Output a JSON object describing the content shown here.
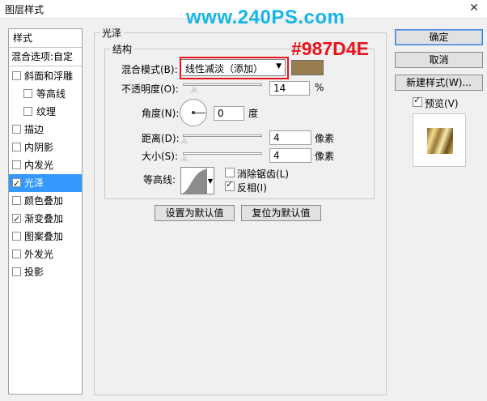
{
  "window": {
    "title": "图层样式",
    "close_glyph": "✕"
  },
  "watermark": "www.240PS.com",
  "annotation_color": "#987D4E",
  "left_list": {
    "header": "样式",
    "blend_options": "混合选项:自定",
    "items": [
      {
        "label": "斜面和浮雕",
        "checked": false
      },
      {
        "label": "等高线",
        "checked": false
      },
      {
        "label": "纹理",
        "checked": false
      },
      {
        "label": "描边",
        "checked": false
      },
      {
        "label": "内阴影",
        "checked": false
      },
      {
        "label": "内发光",
        "checked": false
      },
      {
        "label": "光泽",
        "checked": true,
        "selected": true
      },
      {
        "label": "颜色叠加",
        "checked": false
      },
      {
        "label": "渐变叠加",
        "checked": true
      },
      {
        "label": "图案叠加",
        "checked": false
      },
      {
        "label": "外发光",
        "checked": false
      },
      {
        "label": "投影",
        "checked": false
      }
    ]
  },
  "satin": {
    "group_title": "光泽",
    "structure_title": "结构",
    "blend_mode_label": "混合模式(B):",
    "blend_mode_value": "线性减淡（添加）",
    "color": "#987D4E",
    "opacity_label": "不透明度(O):",
    "opacity_value": "14",
    "opacity_unit": "%",
    "opacity_level": 0.14,
    "angle_label": "角度(N):",
    "angle_value": "0",
    "angle_unit": "度",
    "distance_label": "距离(D):",
    "distance_value": "4",
    "distance_unit": "像素",
    "size_label": "大小(S):",
    "size_value": "4",
    "size_unit": "像素",
    "contour_label": "等高线:",
    "antialias_label": "消除锯齿(L)",
    "antialias_checked": false,
    "invert_label": "反相(I)",
    "invert_checked": true,
    "make_default": "设置为默认值",
    "reset_default": "复位为默认值"
  },
  "right": {
    "ok": "确定",
    "cancel": "取消",
    "new_style": "新建样式(W)...",
    "preview_label": "预览(V)",
    "preview_checked": true
  }
}
